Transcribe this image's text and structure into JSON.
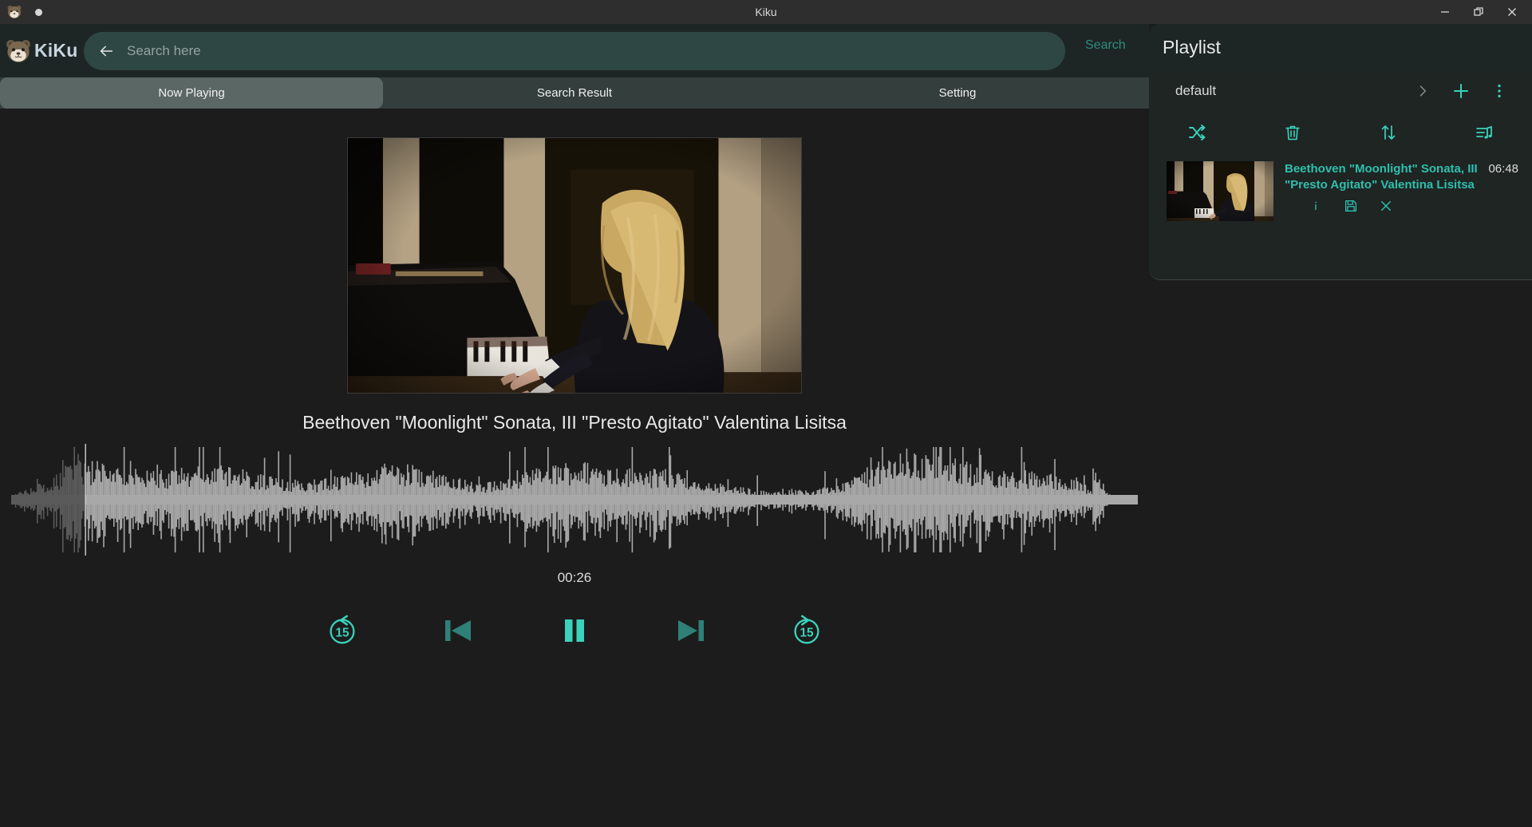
{
  "window": {
    "title": "Kiku",
    "controls": [
      {
        "name": "minimize-button",
        "glyph": "minimize"
      },
      {
        "name": "maximize-button",
        "glyph": "restore"
      },
      {
        "name": "close-button",
        "glyph": "close"
      }
    ]
  },
  "brand": {
    "name": "KiKu",
    "logo_icon": "otter-logo-icon"
  },
  "search": {
    "placeholder": "Search here",
    "value": "",
    "button_label": "Search",
    "back_icon": "arrow-left-icon"
  },
  "tabs": [
    {
      "label": "Now Playing",
      "active": true
    },
    {
      "label": "Search Result",
      "active": false
    },
    {
      "label": "Setting",
      "active": false
    }
  ],
  "now_playing": {
    "title": "Beethoven \"Moonlight\" Sonata, III \"Presto Agitato\" Valentina Lisitsa",
    "current_time": "00:26",
    "artwork_alt": "pianist-at-grand-piano",
    "controls": [
      {
        "name": "rewind-15-button",
        "label": "15",
        "icon": "replay-15-icon"
      },
      {
        "name": "previous-track-button",
        "label": "",
        "icon": "skip-previous-icon"
      },
      {
        "name": "play-pause-button",
        "label": "",
        "icon": "pause-icon"
      },
      {
        "name": "next-track-button",
        "label": "",
        "icon": "skip-next-icon"
      },
      {
        "name": "forward-15-button",
        "label": "15",
        "icon": "forward-15-icon"
      }
    ],
    "waveform": {
      "progress_percent": 6.6,
      "played_color": "#5a5a5a",
      "remaining_color": "#a8a8a8",
      "cursor_color": "#cfcfcf"
    }
  },
  "playlist": {
    "heading": "Playlist",
    "selected": "default",
    "header_actions": [
      {
        "name": "expand-playlist-icon",
        "icon": "chevron-right-icon"
      },
      {
        "name": "add-playlist-button",
        "icon": "plus-icon"
      },
      {
        "name": "playlist-more-menu",
        "icon": "dots-vertical-icon"
      }
    ],
    "tools": [
      {
        "name": "shuffle-button",
        "icon": "shuffle-icon"
      },
      {
        "name": "delete-button",
        "icon": "trash-icon"
      },
      {
        "name": "sort-button",
        "icon": "sort-arrows-icon"
      },
      {
        "name": "queue-button",
        "icon": "playlist-music-icon"
      }
    ],
    "items": [
      {
        "title": "Beethoven \"Moonlight\" Sonata, III \"Presto Agitato\" Valentina Lisitsa",
        "duration": "06:48",
        "actions": [
          {
            "name": "info-button",
            "icon": "info-icon"
          },
          {
            "name": "save-button",
            "icon": "floppy-disk-icon"
          },
          {
            "name": "remove-button",
            "icon": "close-icon"
          }
        ]
      }
    ]
  },
  "colors": {
    "accent_teal": "#3ad2bb",
    "accent_teal_dark": "#2f8178",
    "search_field": "#2f4744",
    "topbar": "#1d2624",
    "tabbar": "#343e3c",
    "tab_active": "#5b6765",
    "background": "#1c1c1c"
  }
}
